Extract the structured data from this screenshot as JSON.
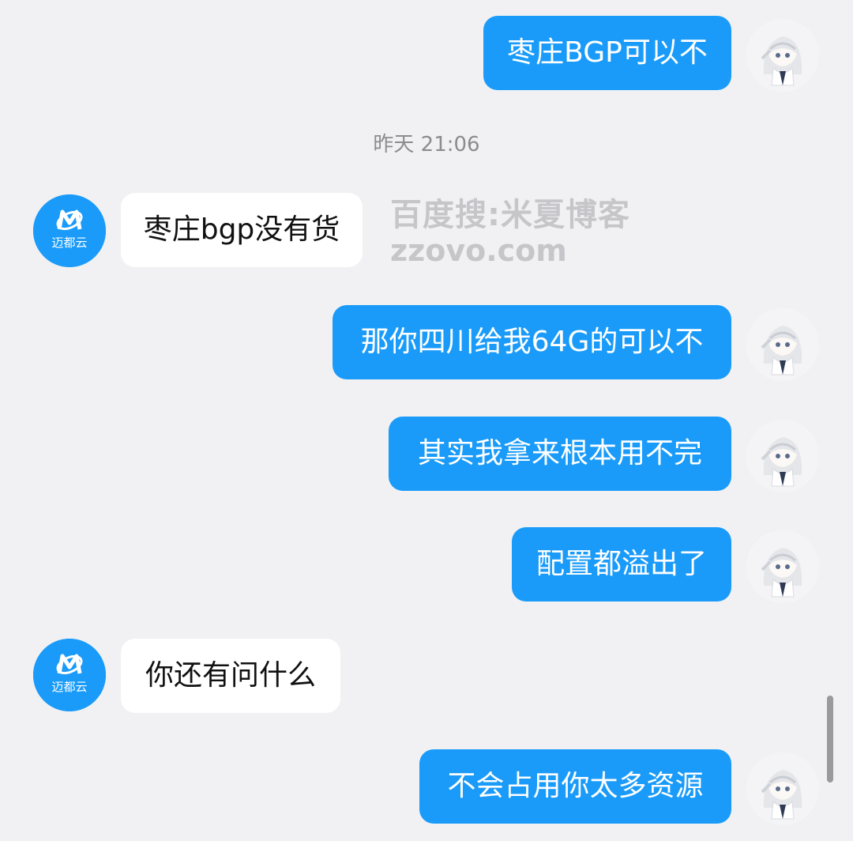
{
  "chat": {
    "timestamp": "昨天 21:06",
    "bot_logo_text": "迈都云",
    "watermark": {
      "line1": "百度搜:米夏博客",
      "line2": "zzovo.com"
    },
    "messages": [
      {
        "from": "self",
        "text": "枣庄BGP可以不"
      },
      {
        "from": "bot",
        "text": "枣庄bgp没有货"
      },
      {
        "from": "self",
        "text": "那你四川给我64G的可以不"
      },
      {
        "from": "self",
        "text": "其实我拿来根本用不完"
      },
      {
        "from": "self",
        "text": "配置都溢出了"
      },
      {
        "from": "bot",
        "text": "你还有问什么"
      },
      {
        "from": "self",
        "text": "不会占用你太多资源"
      }
    ]
  },
  "icons": {
    "self_avatar": "anime-girl-avatar",
    "bot_avatar": "maidu-cloud-logo"
  },
  "colors": {
    "outgoing_bubble": "#1a9bf9",
    "incoming_bubble": "#ffffff",
    "background": "#f1f1f3",
    "timestamp": "#8c8c90"
  }
}
